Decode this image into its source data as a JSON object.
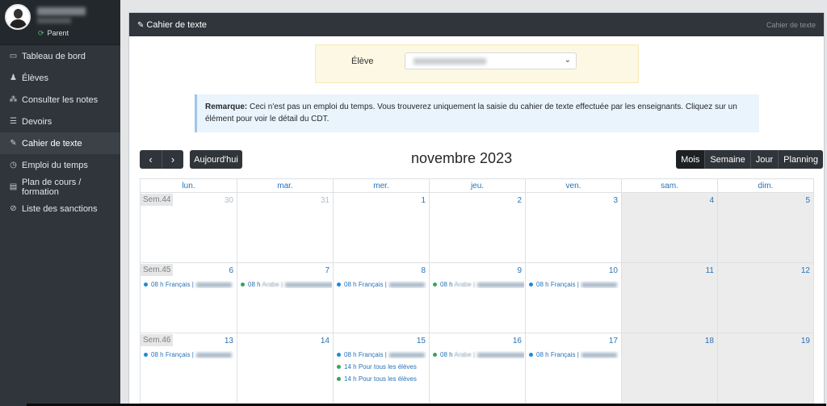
{
  "sidebar": {
    "role": "Parent",
    "items": [
      {
        "label": "Tableau de bord",
        "icon": "laptop-icon",
        "glyph": "▭"
      },
      {
        "label": "Élèves",
        "icon": "user-icon",
        "glyph": "♟"
      },
      {
        "label": "Consulter les notes",
        "icon": "sitemap-icon",
        "glyph": "⁂"
      },
      {
        "label": "Devoirs",
        "icon": "list-icon",
        "glyph": "☰"
      },
      {
        "label": "Cahier de texte",
        "icon": "edit-icon",
        "glyph": "✎"
      },
      {
        "label": "Emploi du temps",
        "icon": "clock-icon",
        "glyph": "◷"
      },
      {
        "label": "Plan de cours / formation",
        "icon": "file-icon",
        "glyph": "▤"
      },
      {
        "label": "Liste des sanctions",
        "icon": "ban-icon",
        "glyph": "⊘"
      }
    ],
    "active_index": 4
  },
  "header": {
    "title": "Cahier de texte",
    "breadcrumb": "Cahier de texte"
  },
  "eleve": {
    "label": "Élève"
  },
  "remark": {
    "bold": "Remarque:",
    "text": " Ceci n'est pas un emploi du temps. Vous trouverez uniquement la saisie du cahier de texte effectuée par les enseignants. Cliquez sur un élément pour voir le détail du CDT."
  },
  "toolbar": {
    "prev": "‹",
    "next": "›",
    "today": "Aujourd'hui",
    "title": "novembre 2023",
    "views": [
      "Mois",
      "Semaine",
      "Jour",
      "Planning"
    ]
  },
  "calendar": {
    "days": [
      "lun.",
      "mar.",
      "mer.",
      "jeu.",
      "ven.",
      "sam.",
      "dim."
    ],
    "weeks": [
      {
        "label": "Sem.44",
        "dates": [
          "30",
          "31",
          "1",
          "2",
          "3",
          "4",
          "5"
        ],
        "other": [
          true,
          true,
          false,
          false,
          false,
          false,
          false
        ]
      },
      {
        "label": "Sem.45",
        "dates": [
          "6",
          "7",
          "8",
          "9",
          "10",
          "11",
          "12"
        ],
        "other": [
          false,
          false,
          false,
          false,
          false,
          false,
          false
        ]
      },
      {
        "label": "Sem.46",
        "dates": [
          "13",
          "14",
          "15",
          "16",
          "17",
          "18",
          "19"
        ],
        "other": [
          false,
          false,
          false,
          false,
          false,
          false,
          false
        ]
      }
    ],
    "events": [
      {
        "week": 1,
        "day": 0,
        "slot": 0,
        "color": "#1e8ad6",
        "time": "08 h",
        "subject": "Français |",
        "blurred": true
      },
      {
        "week": 1,
        "day": 1,
        "slot": 0,
        "color": "#3aa35a",
        "time": "08 h",
        "subject": "Arabe |",
        "blurred": true,
        "green": true
      },
      {
        "week": 1,
        "day": 2,
        "slot": 0,
        "color": "#1e8ad6",
        "time": "08 h",
        "subject": "Français |",
        "blurred": true
      },
      {
        "week": 1,
        "day": 3,
        "slot": 0,
        "color": "#3aa35a",
        "time": "08 h",
        "subject": "Arabe |",
        "blurred": true,
        "green": true
      },
      {
        "week": 1,
        "day": 4,
        "slot": 0,
        "color": "#1e8ad6",
        "time": "08 h",
        "subject": "Français |",
        "blurred": true
      },
      {
        "week": 2,
        "day": 0,
        "slot": 0,
        "color": "#1e8ad6",
        "time": "08 h",
        "subject": "Français |",
        "blurred": true
      },
      {
        "week": 2,
        "day": 2,
        "slot": 0,
        "color": "#1e8ad6",
        "time": "08 h",
        "subject": "Français |",
        "blurred": true
      },
      {
        "week": 2,
        "day": 2,
        "slot": 1,
        "color": "#3aa35a",
        "time": "14 h",
        "subject": "Pour tous les élèves",
        "blurred": false
      },
      {
        "week": 2,
        "day": 2,
        "slot": 2,
        "color": "#3aa35a",
        "time": "14 h",
        "subject": "Pour tous les élèves",
        "blurred": false
      },
      {
        "week": 2,
        "day": 3,
        "slot": 0,
        "color": "#3aa35a",
        "time": "08 h",
        "subject": "Arabe |",
        "blurred": true,
        "green": true
      },
      {
        "week": 2,
        "day": 4,
        "slot": 0,
        "color": "#1e8ad6",
        "time": "08 h",
        "subject": "Français |",
        "blurred": true
      }
    ]
  }
}
